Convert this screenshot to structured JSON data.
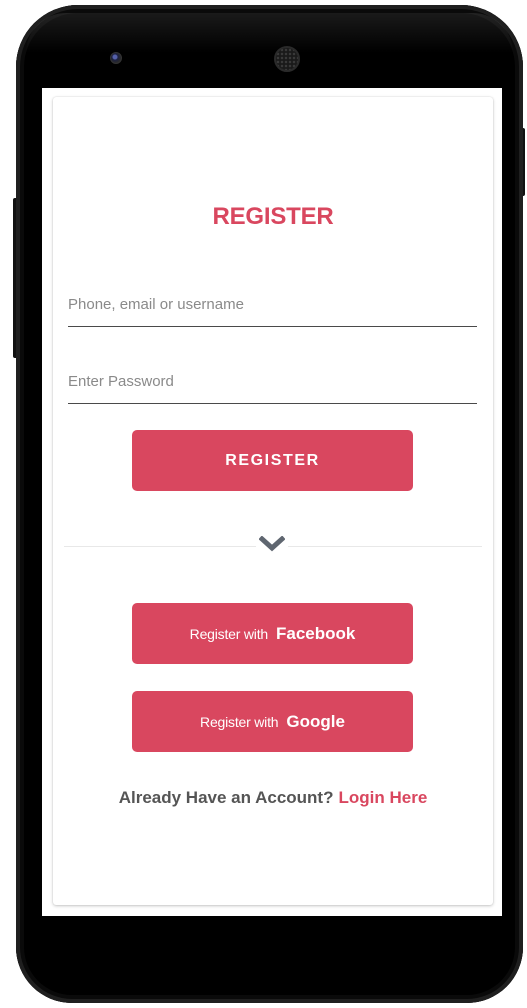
{
  "register": {
    "title": "REGISTER",
    "username_placeholder": "Phone, email or username",
    "password_placeholder": "Enter Password",
    "submit_label": "REGISTER"
  },
  "divider": {
    "icon": "chevron-down-icon"
  },
  "social": {
    "facebook": {
      "prefix": "Register with",
      "brand": "Facebook"
    },
    "google": {
      "prefix": "Register with",
      "brand": "Google"
    }
  },
  "footer": {
    "prompt": "Already Have an Account?",
    "link": "Login Here"
  },
  "colors": {
    "accent": "#d9475f",
    "text_muted": "#555555",
    "placeholder": "#8a8a8a"
  }
}
